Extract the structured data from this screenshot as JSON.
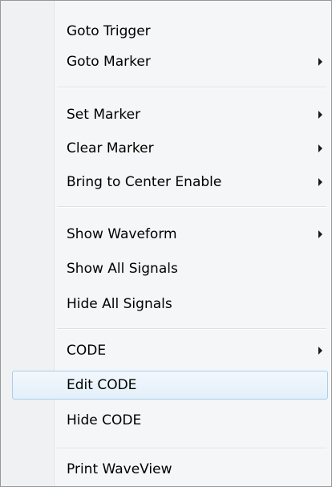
{
  "menu": {
    "items": [
      {
        "label": "Goto Trigger",
        "submenu": false
      },
      {
        "label": "Goto Marker",
        "submenu": true
      },
      {
        "label": "Set Marker",
        "submenu": true
      },
      {
        "label": "Clear Marker",
        "submenu": true
      },
      {
        "label": "Bring to Center Enable",
        "submenu": true
      },
      {
        "label": "Show Waveform",
        "submenu": true
      },
      {
        "label": "Show All Signals",
        "submenu": false
      },
      {
        "label": "Hide All Signals",
        "submenu": false
      },
      {
        "label": "CODE",
        "submenu": true
      },
      {
        "label": "Edit CODE",
        "submenu": false,
        "highlighted": true
      },
      {
        "label": "Hide CODE",
        "submenu": false
      },
      {
        "label": "Print WaveView",
        "submenu": false
      }
    ],
    "submenu_arrow_icon": "triangle-right-icon",
    "highlight_color": "#a9cdee"
  }
}
